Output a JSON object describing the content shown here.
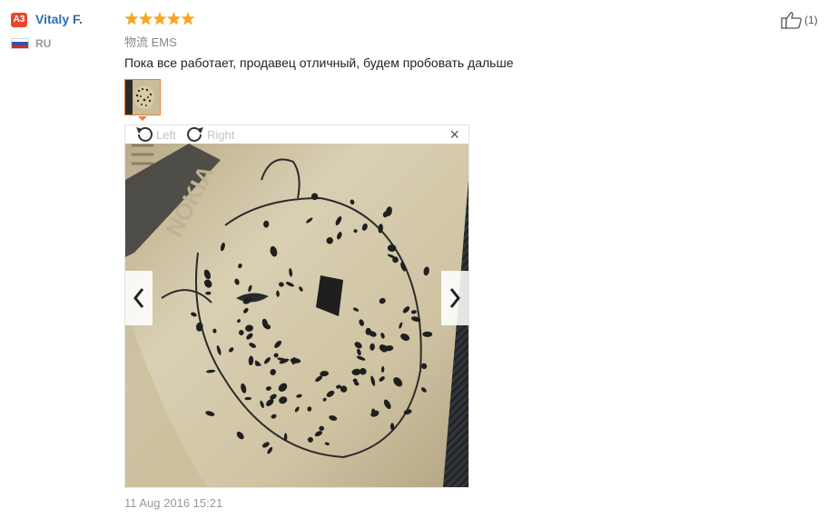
{
  "reviewer": {
    "avatar_initials": "A3",
    "name": "Vitaly F.",
    "country_code": "RU",
    "flag_icon": "russia-flag-icon"
  },
  "review": {
    "rating_stars": 5,
    "rating_max": 5,
    "star_color": "#f5a623",
    "shipping_label": "物流",
    "shipping_method": "EMS",
    "text": "Пока все работает, продавец отличный, будем пробовать дальше",
    "date": "11 Aug 2016 15:21"
  },
  "viewer": {
    "rotate_left_label": "Left",
    "rotate_right_label": "Right",
    "close_label": "×",
    "image_subject": "engraved leopard head on gold NOKIA phone back",
    "image_brand_text": "NOKIA",
    "prev_icon": "chevron-left-icon",
    "next_icon": "chevron-right-icon"
  },
  "helpful": {
    "icon": "thumbs-up-icon",
    "count_label": "(1)"
  },
  "colors": {
    "accent_orange": "#e87e3c",
    "name_blue": "#2a6fb0",
    "badge_red": "#e8472b"
  }
}
